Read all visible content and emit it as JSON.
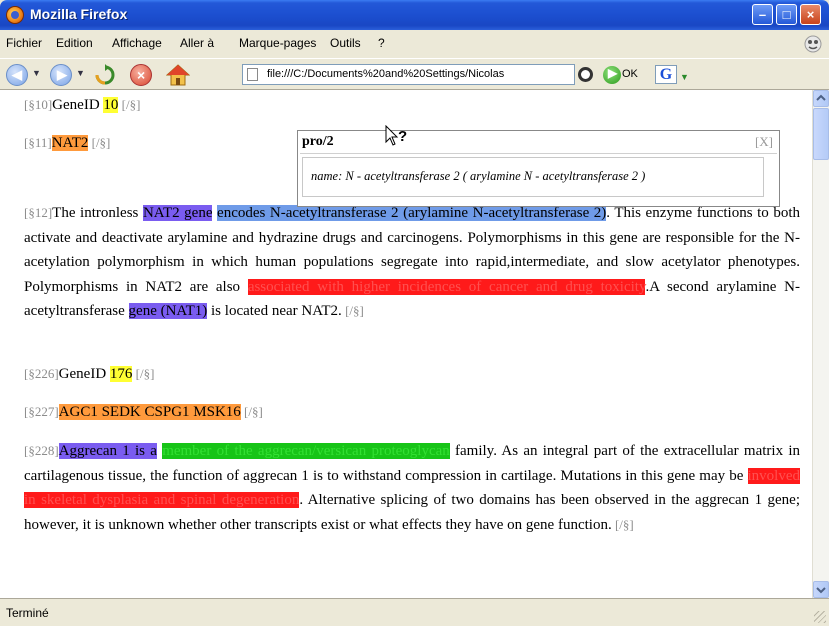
{
  "window": {
    "title": "Mozilla Firefox"
  },
  "menu": [
    "Fichier",
    "Edition",
    "Affichage",
    "Aller à",
    "Marque-pages",
    "Outils",
    "?"
  ],
  "nav": {
    "url": "file:///C:/Documents%20and%20Settings/Nicolas",
    "ok_label": "OK",
    "search_engine": "G",
    "icons": [
      "back-icon",
      "forward-icon",
      "reload-icon",
      "stop-icon",
      "home-icon",
      "page-icon",
      "go-icon",
      "ok-icon",
      "google-icon"
    ]
  },
  "content": {
    "p1": {
      "tag_open": "[§10]",
      "text": "GeneID ",
      "id": "10",
      "tag_close": " [/§]"
    },
    "p2": {
      "tag_open": "[§11]",
      "gene": "NAT2",
      "tag_close": " [/§]"
    },
    "p3": {
      "tag_open": "[§12]",
      "t1": "The intronless ",
      "h_gene": "NAT2 gene",
      "t2": " ",
      "h_encodes": "encodes N-acetyltransferase 2 (arylamine N-acetyltransferase 2)",
      "t3": ". This enzyme functions to both activate ",
      "t3b": "and deactivate arylamine and hydrazine drugs and carcinogens.",
      "t4": " Polymorphisms in this gene are r",
      "t4b": "esponsible for the N-acetylation polymorphism in which human",
      "t5": " populations segregate into rapid,in",
      "t5b": "termediate, and slow acetylator phenotypes. Polymorphisms",
      "t6": " in NAT2 are also ",
      "h_assoc": "associated with higher incidences of cancer and drug toxicity",
      "t7": ".A second arylamine N-acetyltransferase ",
      "h_nat1": "gene (NAT1)",
      "t8": " is located near NAT2.",
      "tag_close": " [/§]"
    },
    "p4": {
      "tag_open": "[§226]",
      "text": "GeneID ",
      "id": "176",
      "tag_close": " [/§]"
    },
    "p5": {
      "tag_open": "[§227]",
      "genes": "AGC1 SEDK CSPG1 MSK16",
      "tag_close": " [/§]"
    },
    "p6": {
      "tag_open": "[§228]",
      "h_aggrecan": "Aggrecan 1 is a",
      "t1": " ",
      "h_member": "member of the aggrecan/versican proteoglycan",
      "t2": " family. As an integral part of the extracellular matrix in cartilagenous tissue, the function of aggrecan 1 is to withstand compression in cartilage. Mutations in this gene may be ",
      "h_involved": "involved in skeletal dysplasia and spinal degeneration",
      "t3": ". Alternative splicing of two domains has been observed in the aggrecan 1 gene; however, it is unknown whether other transcripts exist or what effects they have on gene function.",
      "tag_close": " [/§]"
    }
  },
  "popup": {
    "title": "pro/2",
    "close": "[X]",
    "name_label": "name:",
    "name_value": "N - acetyltransferase 2 ( arylamine N - acetyltransferase 2 )"
  },
  "status": {
    "text": "Terminé"
  },
  "colors": {
    "yellow": "#ffff33",
    "orange": "#ff9a3c",
    "purple": "#7a5cf0",
    "blue": "#6f9be8",
    "red": "#ff1a1a",
    "green": "#17c417"
  }
}
